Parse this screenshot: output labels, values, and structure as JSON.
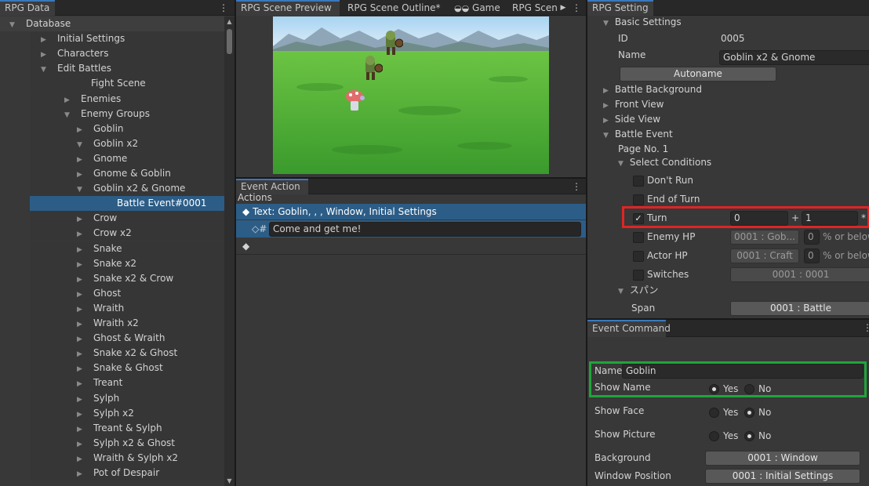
{
  "rpg_data": {
    "tab": "RPG Data",
    "tree": [
      {
        "label": "Database",
        "toggle": "open"
      },
      {
        "label": "Initial Settings",
        "toggle": "closed"
      },
      {
        "label": "Characters",
        "toggle": "closed"
      },
      {
        "label": "Edit Battles",
        "toggle": "open"
      },
      {
        "label": "Fight Scene",
        "toggle": ""
      },
      {
        "label": "Enemies",
        "toggle": "closed"
      },
      {
        "label": "Enemy Groups",
        "toggle": "open"
      },
      {
        "label": "Goblin",
        "toggle": "closed"
      },
      {
        "label": "Goblin x2",
        "toggle": "open"
      },
      {
        "label": "Gnome",
        "toggle": "closed"
      },
      {
        "label": "Gnome & Goblin",
        "toggle": "closed"
      },
      {
        "label": "Goblin x2 & Gnome",
        "toggle": "open"
      },
      {
        "label": "Battle Event#0001",
        "toggle": ""
      },
      {
        "label": "Crow",
        "toggle": "closed"
      },
      {
        "label": "Crow x2",
        "toggle": "closed"
      },
      {
        "label": "Snake",
        "toggle": "closed"
      },
      {
        "label": "Snake x2",
        "toggle": "closed"
      },
      {
        "label": "Snake x2 & Crow",
        "toggle": "closed"
      },
      {
        "label": "Ghost",
        "toggle": "closed"
      },
      {
        "label": "Wraith",
        "toggle": "closed"
      },
      {
        "label": "Wraith x2",
        "toggle": "closed"
      },
      {
        "label": "Ghost & Wraith",
        "toggle": "closed"
      },
      {
        "label": "Snake x2 & Ghost",
        "toggle": "closed"
      },
      {
        "label": "Snake & Ghost",
        "toggle": "closed"
      },
      {
        "label": "Treant",
        "toggle": "closed"
      },
      {
        "label": "Sylph",
        "toggle": "closed"
      },
      {
        "label": "Sylph x2",
        "toggle": "closed"
      },
      {
        "label": "Treant & Sylph",
        "toggle": "closed"
      },
      {
        "label": "Sylph x2 & Ghost",
        "toggle": "closed"
      },
      {
        "label": "Wraith & Sylph x2",
        "toggle": "closed"
      },
      {
        "label": "Pot of Despair",
        "toggle": "closed"
      }
    ]
  },
  "center_tabs": [
    "RPG Scene Preview",
    "RPG Scene Outline*",
    "Game",
    "RPG Scen"
  ],
  "event_action": {
    "tab": "Event Action",
    "actions_label": "Actions",
    "items": [
      {
        "prefix": "◆",
        "text": "Text: Goblin, , , Window, Initial Settings"
      },
      {
        "prefix": "◇#",
        "text": "Come and get me!"
      },
      {
        "prefix": "◆",
        "text": ""
      }
    ]
  },
  "rpg_setting": {
    "tab": "RPG Setting",
    "basic_settings": "Basic Settings",
    "id_label": "ID",
    "id_value": "0005",
    "name_label": "Name",
    "name_value": "Goblin x2 & Gnome",
    "autoname": "Autoname",
    "sections": [
      "Battle Background",
      "Front View",
      "Side View",
      "Battle Event"
    ],
    "page_no": "Page No. 1",
    "select_conditions": "Select Conditions",
    "conditions": {
      "dont_run": "Don't Run",
      "end_of_turn": "End of Turn",
      "turn": "Turn",
      "turn_a": "0",
      "turn_plus": "+",
      "turn_b": "1",
      "turn_star": "*",
      "enemy_hp": "Enemy HP",
      "enemy_hp_target": "0001 : Gob...",
      "enemy_hp_value": "0",
      "enemy_hp_unit": "% or below",
      "actor_hp": "Actor HP",
      "actor_hp_target": "0001 : Craft",
      "actor_hp_value": "0",
      "actor_hp_unit": "% or below",
      "switches": "Switches",
      "switches_value": "0001 : 0001"
    },
    "span_header": "スパン",
    "span_label": "Span",
    "span_value": "0001 : Battle"
  },
  "event_command": {
    "tab": "Event Command",
    "name_label": "Name",
    "name_value": "Goblin",
    "show_name": "Show Name",
    "show_face": "Show Face",
    "show_picture": "Show Picture",
    "yes": "Yes",
    "no": "No",
    "show_name_choice": "yes",
    "show_face_choice": "no",
    "show_picture_choice": "no",
    "background_label": "Background",
    "background_value": "0001 : Window",
    "window_position_label": "Window Position",
    "window_position_value": "0001 : Initial Settings"
  },
  "colors": {
    "highlight_red": "#e02424",
    "highlight_green": "#1fa53a",
    "selection": "#2c5d87",
    "panel": "#383838"
  }
}
